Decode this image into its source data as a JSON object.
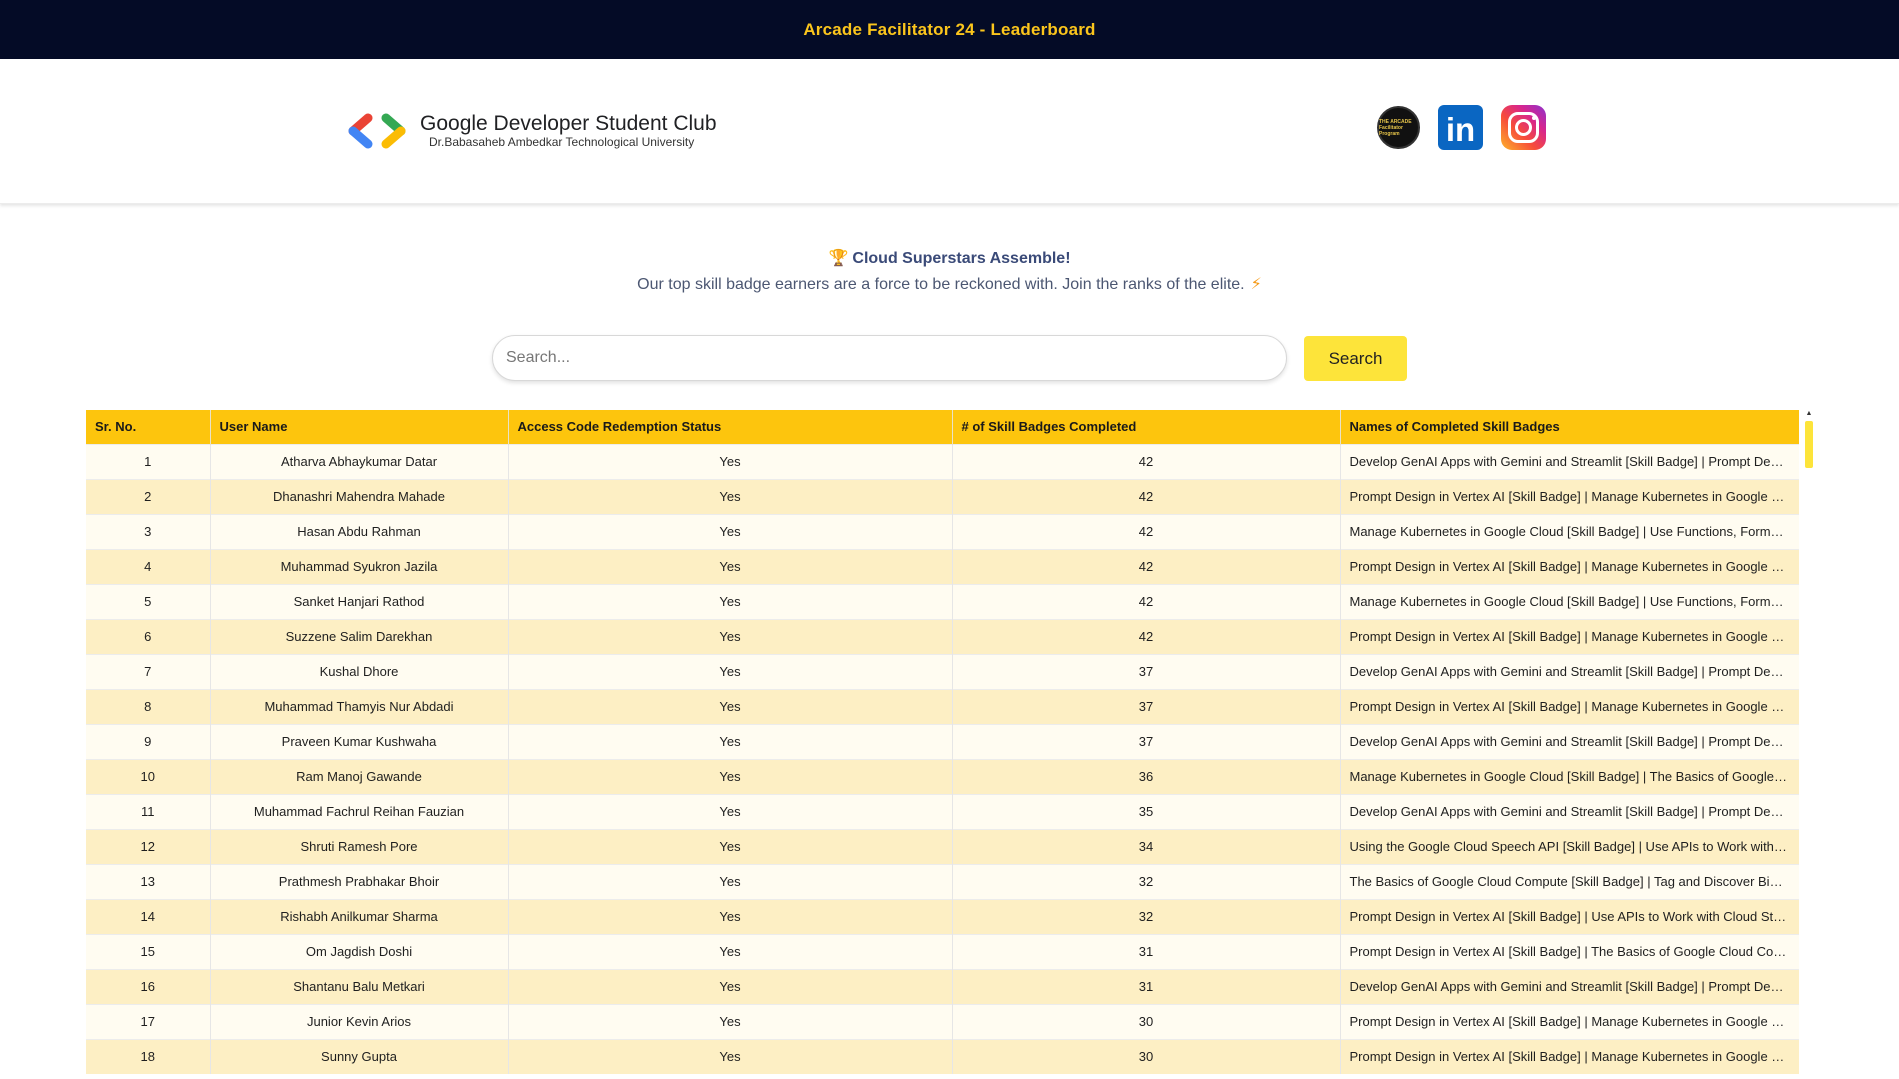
{
  "topbar": {
    "title": "Arcade Facilitator 24 - Leaderboard"
  },
  "brand": {
    "name": "Google Developer Student Club",
    "university": "Dr.Babasaheb Ambedkar Technological University",
    "logo_icon": "gdsc-brackets-logo",
    "colors": {
      "red": "#ea4335",
      "blue": "#4285f4",
      "green": "#34a853",
      "yellow": "#fbbc04"
    }
  },
  "socials": [
    {
      "icon": "arcade-badge-icon",
      "text": "THE ARCADE Facilitator Program"
    },
    {
      "icon": "linkedin-icon",
      "text": "in"
    },
    {
      "icon": "instagram-icon"
    }
  ],
  "hero": {
    "trophy": "🏆",
    "heading": "Cloud Superstars Assemble!",
    "subtitle": "Our top skill badge earners are a force to be reckoned with. Join the ranks of the elite.",
    "bolt": "⚡"
  },
  "search": {
    "placeholder": "Search...",
    "value": "",
    "button_label": "Search"
  },
  "table": {
    "header_color": "#fdc50d",
    "columns": [
      "Sr. No.",
      "User Name",
      "Access Code Redemption Status",
      "# of Skill Badges Completed",
      "Names of Completed Skill Badges"
    ],
    "rows": [
      [
        "1",
        "Atharva Abhaykumar Datar",
        "Yes",
        "42",
        "Develop GenAI Apps with Gemini and Streamlit [Skill Badge] | Prompt Desig..."
      ],
      [
        "2",
        "Dhanashri Mahendra Mahade",
        "Yes",
        "42",
        "Prompt Design in Vertex AI [Skill Badge] | Manage Kubernetes in Google Cl..."
      ],
      [
        "3",
        "Hasan Abdu Rahman",
        "Yes",
        "42",
        "Manage Kubernetes in Google Cloud [Skill Badge] | Use Functions, Formula..."
      ],
      [
        "4",
        "Muhammad Syukron Jazila",
        "Yes",
        "42",
        "Prompt Design in Vertex AI [Skill Badge] | Manage Kubernetes in Google Cl..."
      ],
      [
        "5",
        "Sanket Hanjari Rathod",
        "Yes",
        "42",
        "Manage Kubernetes in Google Cloud [Skill Badge] | Use Functions, Formula..."
      ],
      [
        "6",
        "Suzzene Salim Darekhan",
        "Yes",
        "42",
        "Prompt Design in Vertex AI [Skill Badge] | Manage Kubernetes in Google Cl..."
      ],
      [
        "7",
        "Kushal Dhore",
        "Yes",
        "37",
        "Develop GenAI Apps with Gemini and Streamlit [Skill Badge] | Prompt Desig..."
      ],
      [
        "8",
        "Muhammad Thamyis Nur Abdadi",
        "Yes",
        "37",
        "Prompt Design in Vertex AI [Skill Badge] | Manage Kubernetes in Google Cl..."
      ],
      [
        "9",
        "Praveen Kumar Kushwaha",
        "Yes",
        "37",
        "Develop GenAI Apps with Gemini and Streamlit [Skill Badge] | Prompt Desig..."
      ],
      [
        "10",
        "Ram Manoj Gawande",
        "Yes",
        "36",
        "Manage Kubernetes in Google Cloud [Skill Badge] | The Basics of Google Cl..."
      ],
      [
        "11",
        "Muhammad Fachrul Reihan Fauzian",
        "Yes",
        "35",
        "Develop GenAI Apps with Gemini and Streamlit [Skill Badge] | Prompt Desig..."
      ],
      [
        "12",
        "Shruti Ramesh Pore",
        "Yes",
        "34",
        "Using the Google Cloud Speech API [Skill Badge] | Use APIs to Work with Cl..."
      ],
      [
        "13",
        "Prathmesh Prabhakar Bhoir",
        "Yes",
        "32",
        "The Basics of Google Cloud Compute [Skill Badge] | Tag and Discover BigL..."
      ],
      [
        "14",
        "Rishabh Anilkumar Sharma",
        "Yes",
        "32",
        "Prompt Design in Vertex AI [Skill Badge] | Use APIs to Work with Cloud Stor..."
      ],
      [
        "15",
        "Om Jagdish Doshi",
        "Yes",
        "31",
        "Prompt Design in Vertex AI [Skill Badge] | The Basics of Google Cloud Com..."
      ],
      [
        "16",
        "Shantanu Balu Metkari",
        "Yes",
        "31",
        "Develop GenAI Apps with Gemini and Streamlit [Skill Badge] | Prompt Desig..."
      ],
      [
        "17",
        "Junior Kevin Arios",
        "Yes",
        "30",
        "Prompt Design in Vertex AI [Skill Badge] | Manage Kubernetes in Google Cl..."
      ],
      [
        "18",
        "Sunny Gupta",
        "Yes",
        "30",
        "Prompt Design in Vertex AI [Skill Badge] | Manage Kubernetes in Google Cl..."
      ]
    ]
  }
}
